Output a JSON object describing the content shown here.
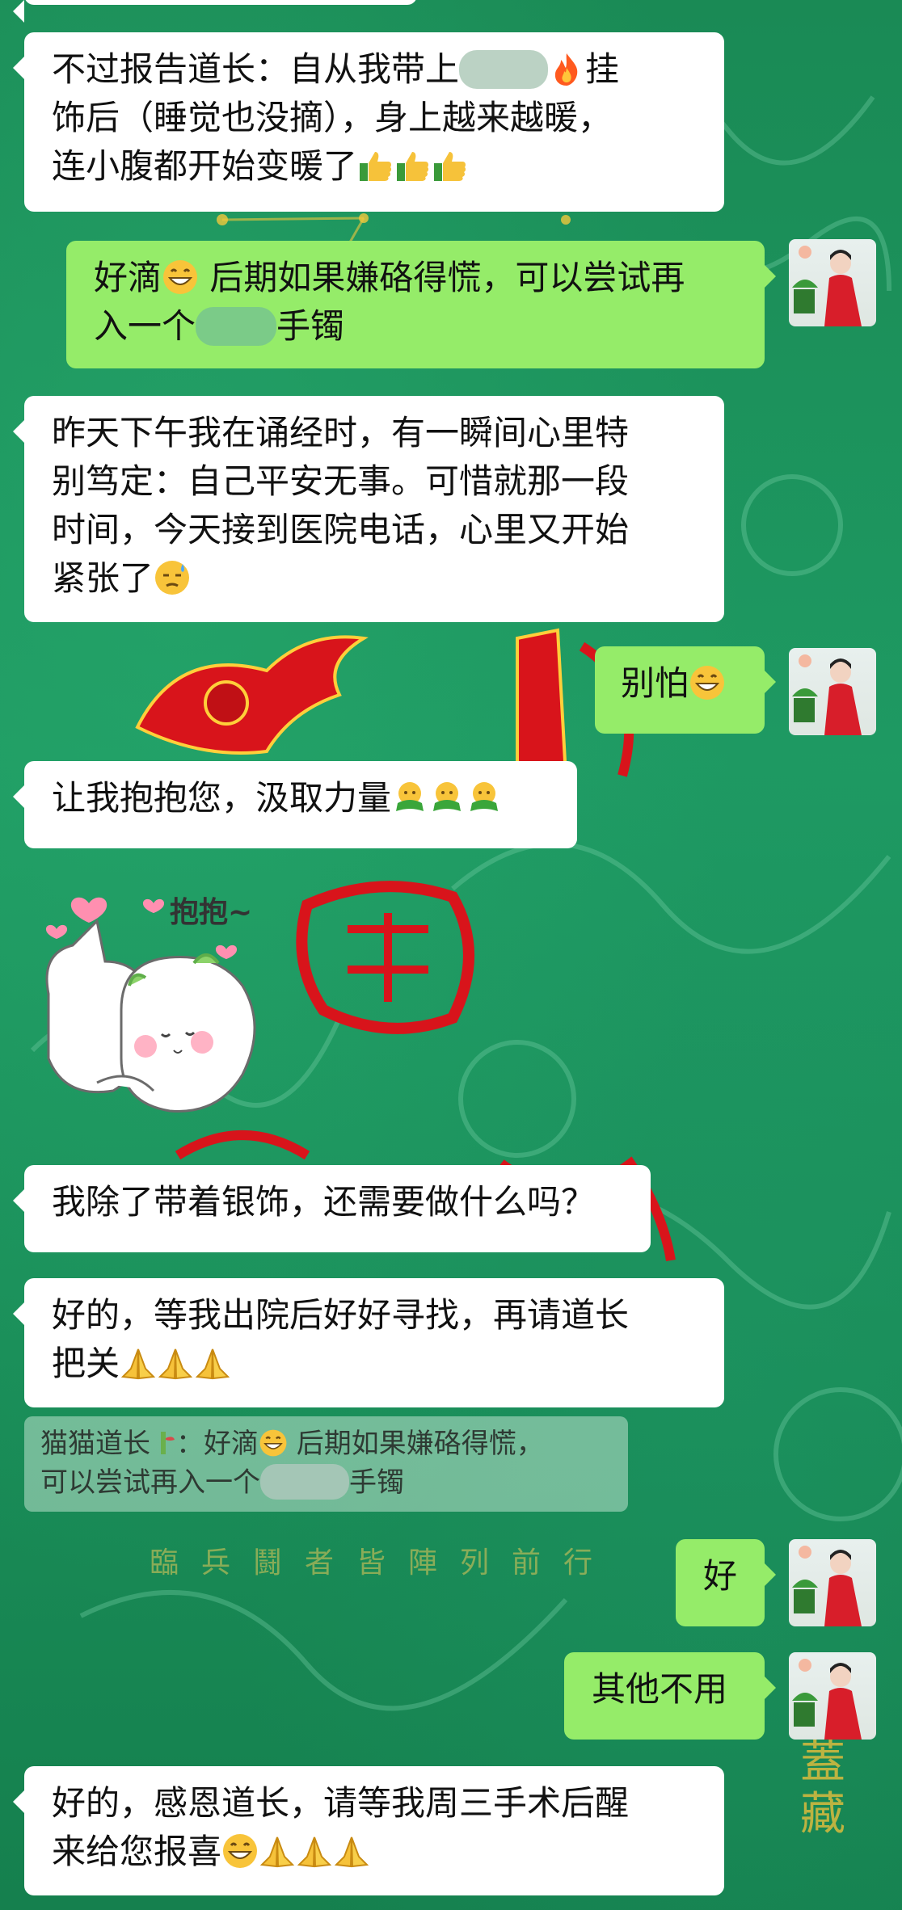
{
  "background": {
    "decor_chars": [
      "𩙿",
      "府",
      "团"
    ],
    "gold_row": "臨兵鬪者皆陣列前行",
    "gold_vertical": "蓋藏"
  },
  "messages": [
    {
      "id": "m1",
      "side": "left",
      "lines": [
        "不过报告道长：自从我带上",
        "挂",
        "饰后（睡觉也没摘），身上越来越暖，",
        "连小腹都开始变暖了"
      ]
    },
    {
      "id": "m2",
      "side": "right",
      "lines": [
        "好滴",
        " 后期如果嫌硌得慌，可以尝试再",
        "入一个",
        "手镯"
      ]
    },
    {
      "id": "m3",
      "side": "left",
      "lines": [
        "昨天下午我在诵经时，有一瞬间心里特",
        "别笃定：自己平安无事。可惜就那一段",
        "时间，今天接到医院电话，心里又开始",
        "紧张了"
      ]
    },
    {
      "id": "m4",
      "side": "right",
      "text": "别怕"
    },
    {
      "id": "m5",
      "side": "left",
      "text": "让我抱抱您，汲取力量"
    },
    {
      "id": "m6",
      "side": "left",
      "text": "我除了带着银饰，还需要做什么吗？"
    },
    {
      "id": "m7",
      "side": "left",
      "lines": [
        "好的，等我出院后好好寻找，再请道长",
        "把关"
      ]
    },
    {
      "id": "m8",
      "side": "right",
      "text": "好"
    },
    {
      "id": "m9",
      "side": "right",
      "text": "其他不用"
    },
    {
      "id": "m10",
      "side": "left",
      "lines": [
        "好的，感恩道长，请等我周三手术后醒",
        "来给您报喜"
      ]
    }
  ],
  "quote": {
    "sender": "猫猫道长",
    "line1": "：好滴",
    "line1b": " 后期如果嫌硌得慌，",
    "line2a": "可以尝试再入一个",
    "line2b": "手镯"
  },
  "sticker": {
    "text": "抱抱~"
  },
  "colors": {
    "right_bubble": "#95ec69",
    "left_bubble": "#ffffff",
    "background": "#1f8f5a",
    "accent_red": "#d8141b"
  },
  "icons": [
    "fire-icon",
    "thumbs-up-icon",
    "grin-icon",
    "sweat-icon",
    "hug-icon",
    "pray-icon"
  ]
}
